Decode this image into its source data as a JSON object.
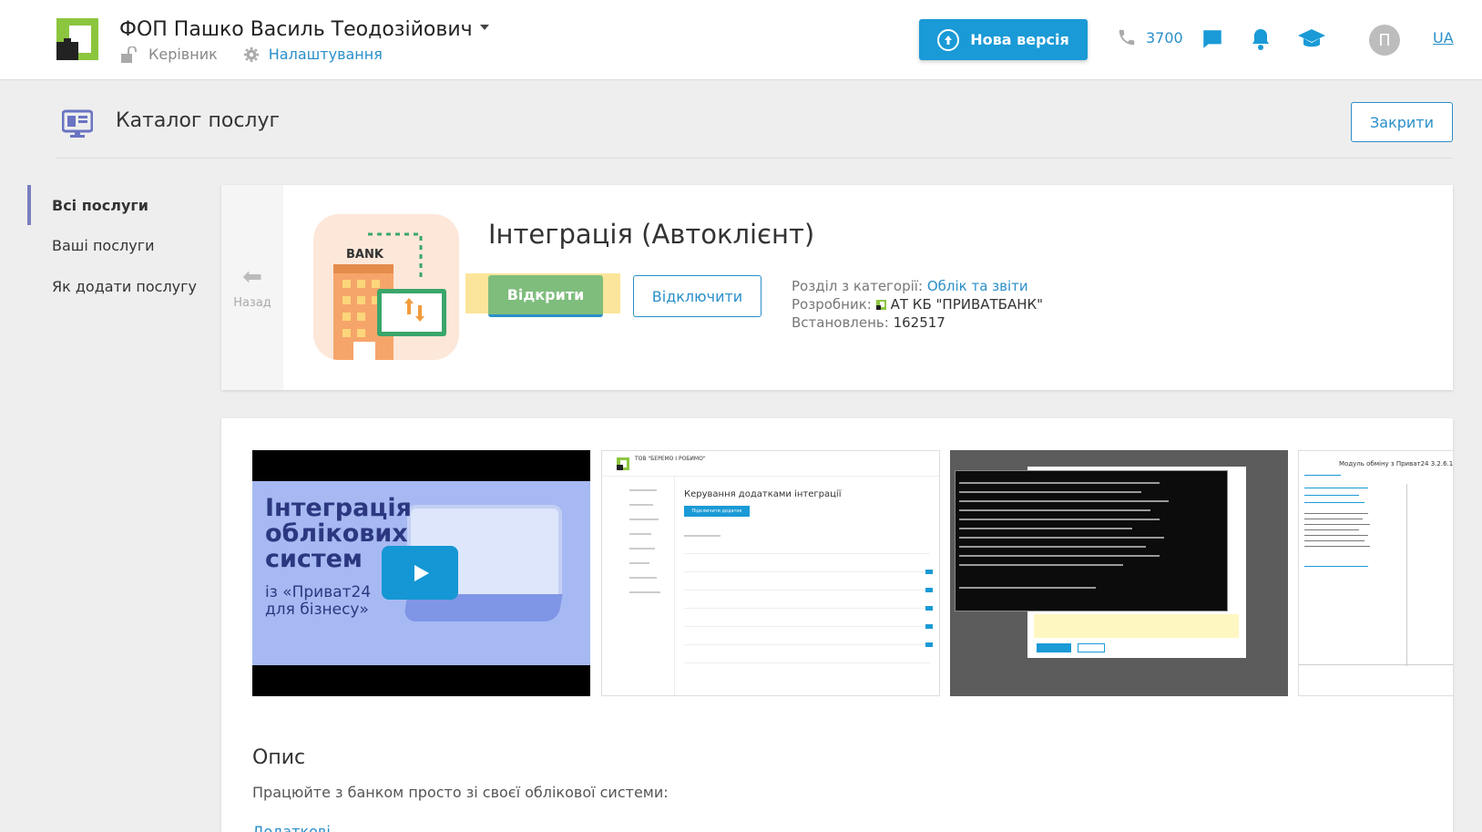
{
  "header": {
    "company_name": "ФОП Пашко Василь Теодозійович",
    "role": "Керівник",
    "settings_label": "Налаштування",
    "new_version_label": "Нова версія",
    "phone": "3700",
    "avatar_letter": "П",
    "language": "UA",
    "colors": {
      "accent": "#1a9ad6",
      "brand_green": "#8cc63f"
    }
  },
  "catalog": {
    "title": "Каталог послуг",
    "close_label": "Закрити"
  },
  "sidebar": {
    "items": [
      {
        "label": "Всі послуги",
        "active": true
      },
      {
        "label": "Ваші послуги",
        "active": false
      },
      {
        "label": "Як додати послугу",
        "active": false
      }
    ]
  },
  "service": {
    "back_label": "Назад",
    "image_text": "BANK",
    "title": "Інтеграція (Автоклієнт)",
    "open_label": "Відкрити",
    "disable_label": "Відключити",
    "category_label": "Розділ з категорії:",
    "category_value": "Облік та звіти",
    "developer_label": "Розробник:",
    "developer_value": "АТ КБ \"ПРИВАТБАНК\"",
    "installed_label": "Встановлень:",
    "installed_value": "162517"
  },
  "gallery": {
    "video": {
      "headline_1": "Інтеграція",
      "headline_2": "облікових",
      "headline_3": "систем",
      "sub_1": "із «Приват24",
      "sub_2": "для бізнесу»"
    },
    "shot2": {
      "company": "ТОВ \"БЕРЕМО І РОБИМО\"",
      "heading": "Керування додатками інтеграції",
      "add_button": "Підключити додаток"
    },
    "shot4": {
      "title": "Модуль обміну з Приват24 3.2.6.15"
    }
  },
  "description": {
    "title": "Опис",
    "text": "Працюйте з банком просто зі своєї облікової системи:",
    "more": "Додаткові"
  }
}
